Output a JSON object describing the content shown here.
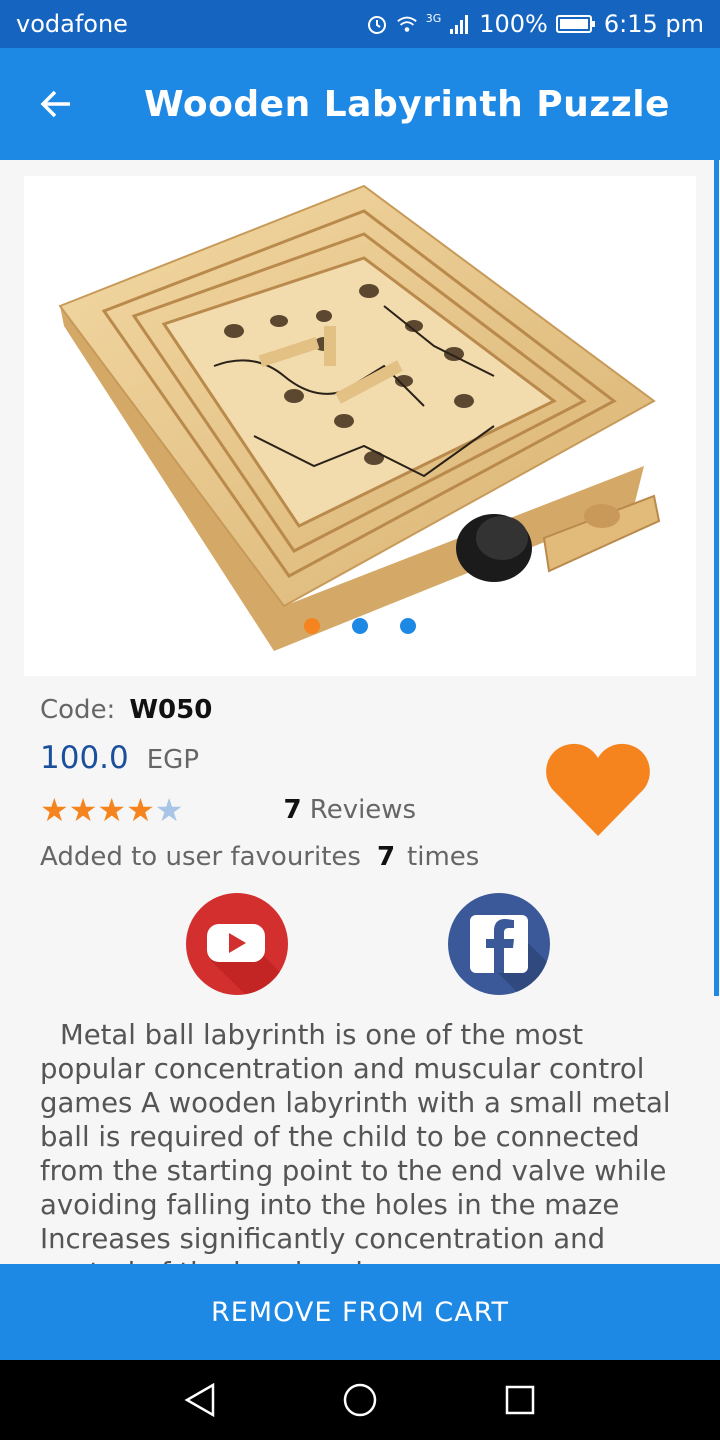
{
  "status": {
    "carrier": "vodafone",
    "network": "3G",
    "battery": "100%",
    "time": "6:15 pm"
  },
  "header": {
    "title": "Wooden Labyrinth Puzzle"
  },
  "gallery": {
    "page_count": 3,
    "active_page": 1,
    "active_color": "#f5841f",
    "inactive_color": "#1e88e5"
  },
  "product": {
    "code_label": "Code:",
    "code": "W050",
    "price": "100.0",
    "currency": "EGP",
    "rating": 4,
    "rating_max": 5,
    "reviews_count": "7",
    "reviews_label": "Reviews",
    "fav_prefix": "Added to user favourites",
    "fav_count": "7",
    "fav_suffix": "times",
    "description": "Metal ball labyrinth is one of the most popular concentration and muscular control games A wooden labyrinth with a small metal ball is required of the child to be connected from the starting point to the end valve while avoiding falling into the holes in the maze Increases significantly concentration and control of the hand and"
  },
  "actions": {
    "favourite_icon": "heart-icon",
    "youtube_icon": "youtube-icon",
    "facebook_icon": "facebook-icon",
    "cart_button": "REMOVE FROM CART"
  },
  "colors": {
    "primary": "#1e88e5",
    "status_bar": "#1565c0",
    "accent": "#f5841f",
    "star_filled": "#f5841f",
    "star_empty": "#a8c4e6"
  }
}
